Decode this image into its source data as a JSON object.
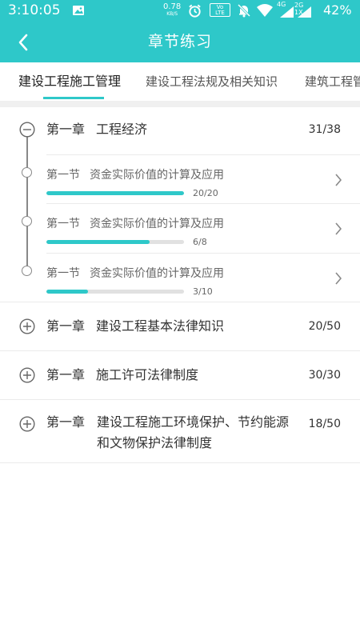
{
  "status_bar": {
    "time": "3:10:05",
    "speed_value": "0.78",
    "speed_unit": "KB/S",
    "volte_top": "Vo",
    "volte_bottom": "LTE",
    "network_4g": "4G",
    "network_2g": "2G",
    "network_1x": "1X",
    "battery": "42%"
  },
  "app_bar": {
    "title": "章节练习"
  },
  "tabs": [
    {
      "label": "建设工程施工管理",
      "active": true
    },
    {
      "label": "建设工程法规及相关知识",
      "active": false
    },
    {
      "label": "建筑工程管理与实务",
      "active": false
    }
  ],
  "chapters": [
    {
      "label": "第一章",
      "name": "工程经济",
      "count": "31/38",
      "expanded": true,
      "sections": [
        {
          "label": "第一节",
          "name": "资金实际价值的计算及应用",
          "count": "20/20",
          "progress": 1.0
        },
        {
          "label": "第一节",
          "name": "资金实际价值的计算及应用",
          "count": "6/8",
          "progress": 0.75
        },
        {
          "label": "第一节",
          "name": "资金实际价值的计算及应用",
          "count": "3/10",
          "progress": 0.3
        }
      ]
    },
    {
      "label": "第一章",
      "name": "建设工程基本法律知识",
      "count": "20/50",
      "expanded": false
    },
    {
      "label": "第一章",
      "name": "施工许可法律制度",
      "count": "30/30",
      "expanded": false
    },
    {
      "label": "第一章",
      "name": "建设工程施工环境保护、节约能源和文物保护法律制度",
      "count": "18/50",
      "expanded": false
    }
  ],
  "colors": {
    "accent": "#2ec8c9",
    "track": "#e1e1e1",
    "line": "#888888"
  },
  "icons": {
    "back": "back-arrow-icon",
    "collapse": "minus-circle-icon",
    "expand": "plus-circle-icon",
    "chevron": "chevron-right-icon"
  }
}
